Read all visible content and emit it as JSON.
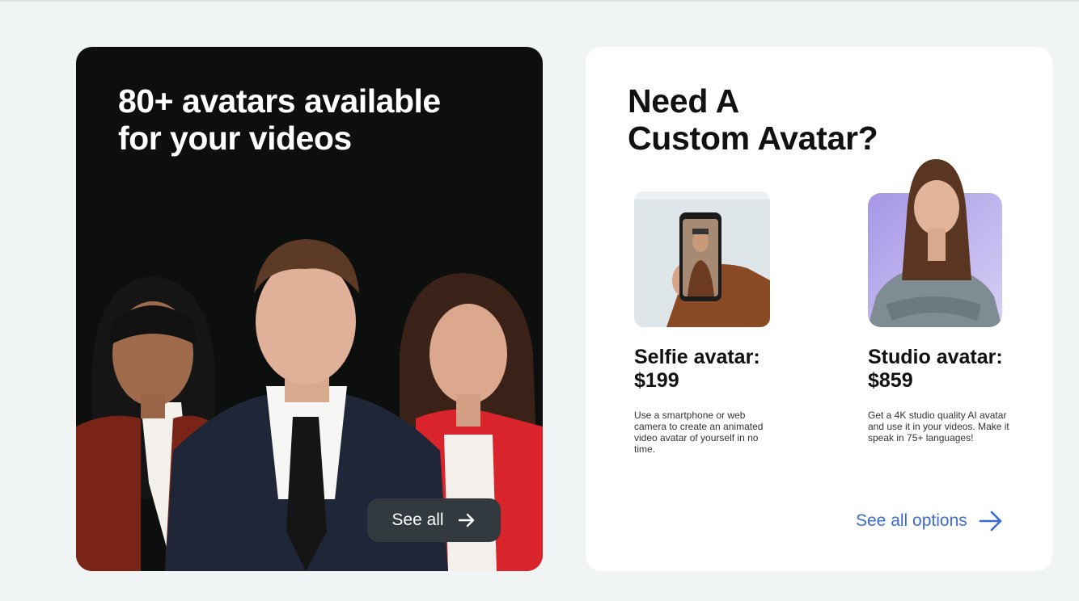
{
  "left_card": {
    "title_line1": "80+ avatars available",
    "title_line2": "for your videos",
    "button_label": "See all"
  },
  "right_card": {
    "title_line1": "Need A",
    "title_line2": "Custom Avatar?",
    "options": [
      {
        "name": "Selfie avatar:",
        "price": "$199",
        "description": "Use a smartphone or web camera to create an animated video avatar of yourself in no time."
      },
      {
        "name": "Studio avatar:",
        "price": "$859",
        "description": "Get a 4K studio quality AI avatar and use it in your videos. Make it speak in 75+ languages!"
      }
    ],
    "link_label": "See all options"
  },
  "colors": {
    "page_bg": "#f1f4f5",
    "dark_card": "#0d0e0e",
    "button_bg": "#323a40",
    "link": "#3d6bd6"
  }
}
